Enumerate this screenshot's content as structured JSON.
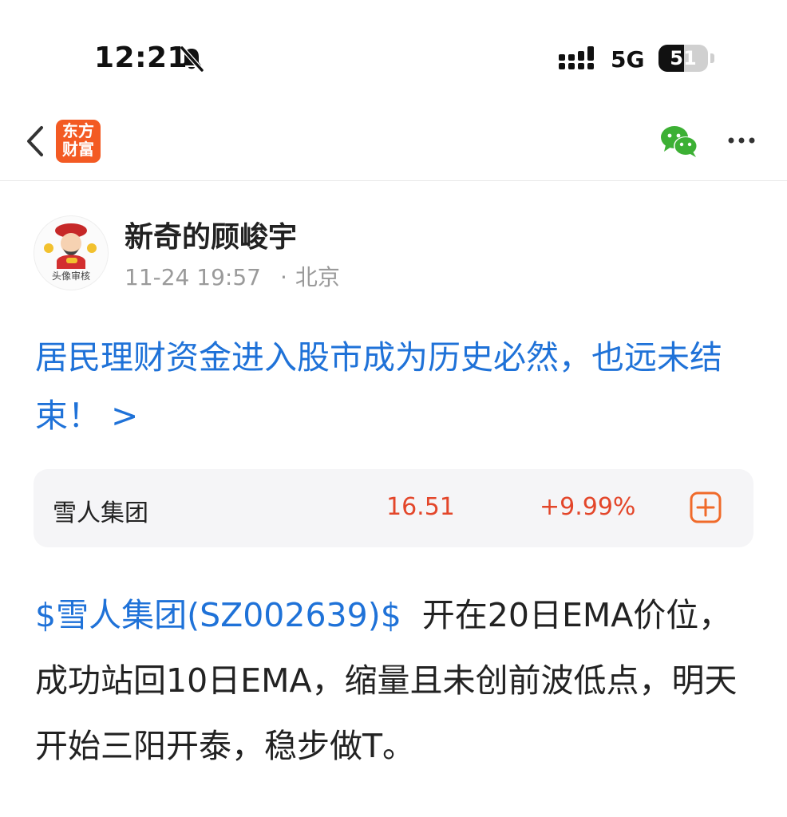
{
  "status_bar": {
    "time": "12:21",
    "network": "5G",
    "battery_level": "51",
    "battery_fraction": 0.51
  },
  "nav": {
    "back_icon": "chevron-left-icon",
    "logo_line1": "东方",
    "logo_line2": "财富",
    "share_icon": "wechat-icon",
    "more_icon": "ellipsis-icon",
    "brand_color": "#f35a23"
  },
  "author": {
    "name": "新奇的顾峻宇",
    "avatar_watermark": "头像审核",
    "date": "11-24 19:57",
    "separator": "·",
    "location": "北京"
  },
  "post": {
    "title": "居民理财资金进入股市成为历史必然，也远未结束！ >",
    "stock_link": "$雪人集团(SZ002639)$",
    "body": "开在20日EMA价位，成功站回10日EMA，缩量且未创前波低点，明天开始三阳开泰，稳步做T。",
    "link_color": "#1f72d8"
  },
  "stock_card": {
    "name": "雪人集团",
    "price": "16.51",
    "change": "+9.99%",
    "add_icon": "plus-square-icon",
    "up_color": "#e3462a"
  }
}
